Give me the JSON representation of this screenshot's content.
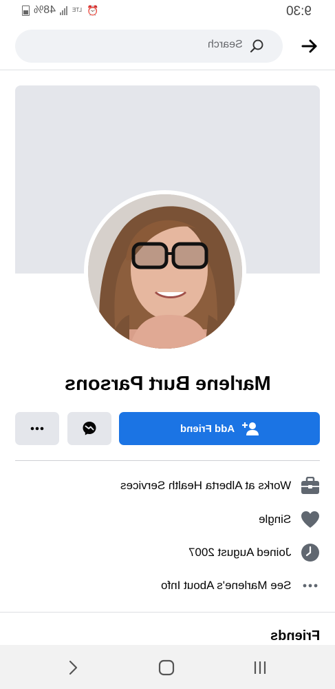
{
  "status_bar": {
    "time": "9:30",
    "battery_pct": "48%",
    "network": "LTE"
  },
  "header": {
    "search_placeholder": "Search"
  },
  "profile": {
    "name": "Marlene Burt Parsons",
    "add_friend_label": "Add Friend"
  },
  "info": [
    {
      "icon": "briefcase-icon",
      "text": "Works at Alberta Health Services"
    },
    {
      "icon": "heart-icon",
      "text": "Single"
    },
    {
      "icon": "clock-icon",
      "text": "Joined August 2007"
    },
    {
      "icon": "more-dots-icon",
      "text": "See Marlene's About Info"
    }
  ],
  "friends_title": "Friends",
  "colors": {
    "accent": "#1b74e4",
    "secondary_button": "#e4e6eb",
    "icon_gray": "#606770"
  }
}
